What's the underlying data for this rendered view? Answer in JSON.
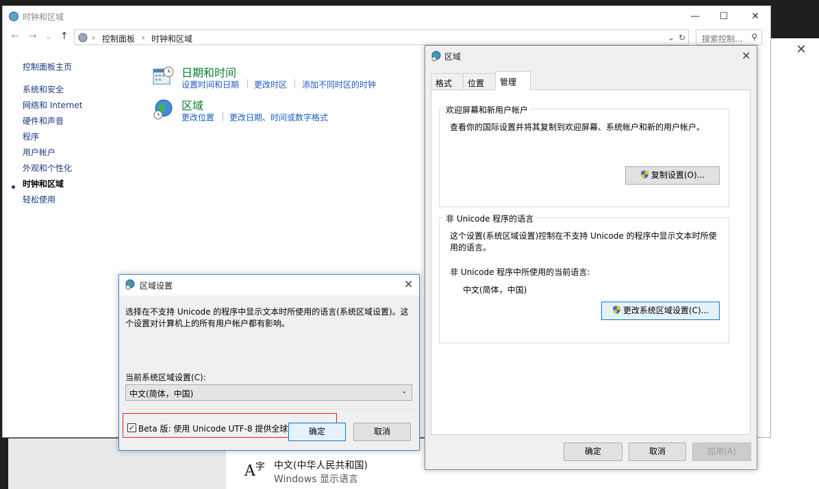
{
  "control_panel": {
    "window_title": "时钟和区域",
    "breadcrumb": [
      "控制面板",
      "时钟和区域"
    ],
    "search_placeholder": "搜索控制...",
    "sidebar": {
      "home": "控制面板主页",
      "items": [
        "系统和安全",
        "网络和 Internet",
        "硬件和声音",
        "程序",
        "用户帐户",
        "外观和个性化",
        "时钟和区域",
        "轻松使用"
      ],
      "active_index": 6
    },
    "categories": [
      {
        "title": "日期和时间",
        "links": [
          "设置时间和日期",
          "更改时区",
          "添加不同时区的时钟"
        ]
      },
      {
        "title": "区域",
        "links": [
          "更改位置",
          "更改日期、时间或数字格式"
        ]
      }
    ]
  },
  "region_dialog": {
    "title": "区域",
    "tabs": [
      "格式",
      "位置",
      "管理"
    ],
    "active_tab": "管理",
    "welcome_group": {
      "label": "欢迎屏幕和新用户帐户",
      "text": "查看你的国际设置并将其复制到欢迎屏幕、系统帐户和新的用户帐户。",
      "button": "复制设置(O)..."
    },
    "unicode_group": {
      "label": "非 Unicode 程序的语言",
      "text_line1": "这个设置(系统区域设置)控制在不支持 Unicode 的程序中显示文本时所使",
      "text_line2": "用的语言。",
      "current_label": "非 Unicode 程序中所使用的当前语言:",
      "current_value": "中文(简体，中国)",
      "button": "更改系统区域设置(C)..."
    },
    "buttons": {
      "ok": "确定",
      "cancel": "取消",
      "apply": "应用(A)"
    }
  },
  "region_settings": {
    "title": "区域设置",
    "text_line1": "选择在不支持 Unicode 的程序中显示文本时所使用的语言(系统区域设置)。这",
    "text_line2": "个设置对计算机上的所有用户帐户都有影响。",
    "current_label": "当前系统区域设置(C):",
    "selected_locale": "中文(简体，中国)",
    "beta_label": "Beta 版: 使用 Unicode UTF-8 提供全球语言支持(U)",
    "beta_checked": true,
    "buttons": {
      "ok": "确定",
      "cancel": "取消"
    }
  },
  "settings_bg": {
    "language_name": "中文(中华人民共和国)",
    "language_sub": "Windows 显示语言"
  }
}
